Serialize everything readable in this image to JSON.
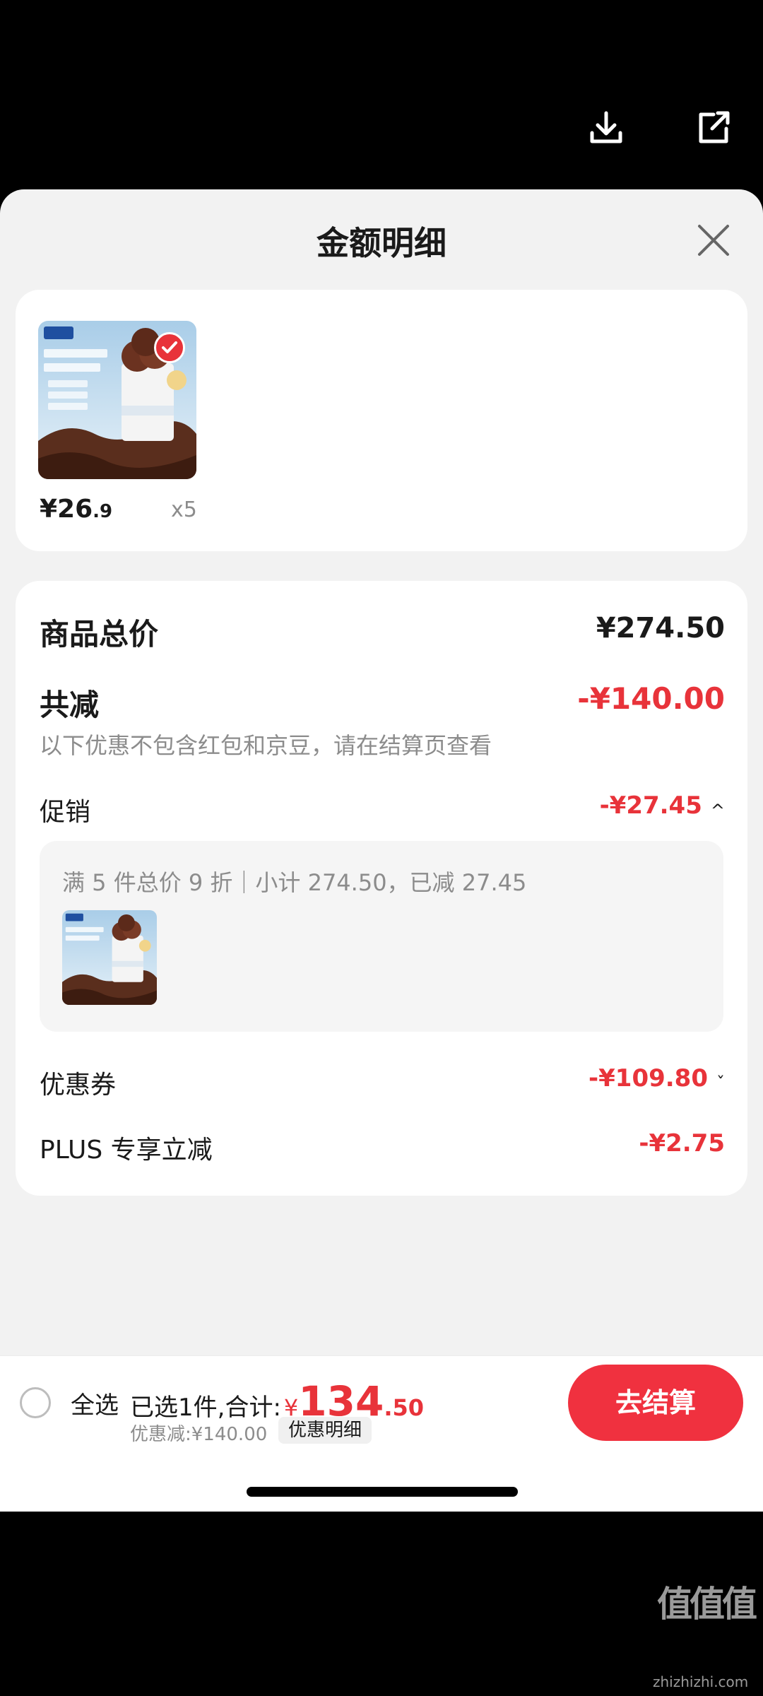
{
  "topbar": {
    "download_icon": "download-icon",
    "share_icon": "share-icon"
  },
  "sheet": {
    "title": "金额明细",
    "close_icon": "close-icon"
  },
  "product": {
    "image": "ice-cream-product-image",
    "checked": true,
    "price_main": "¥26",
    "price_decimal": ".9",
    "quantity": "x5"
  },
  "summary": {
    "total_label": "商品总价",
    "total_value": "¥274.50",
    "reduction_label": "共减",
    "reduction_value": "-¥140.00",
    "note": "以下优惠不包含红包和京豆，请在结算页查看",
    "promo_label": "促销",
    "promo_value": "-¥27.45",
    "promo_caret": "^",
    "promo_detail": "满 5 件总价 9 折｜小计 274.50，已减 27.45",
    "coupon_label": "优惠券",
    "coupon_value": "-¥109.80",
    "coupon_caret": "ˇ",
    "plus_label": "PLUS 专享立减",
    "plus_value": "-¥2.75"
  },
  "bottom_bar": {
    "select_all": "全选",
    "selected_text": "已选1件,合计:",
    "currency": "¥",
    "total_int": "134",
    "total_dec": ".50",
    "discount_note": "优惠减:¥140.00",
    "detail_tag": "优惠明细",
    "checkout": "去结算"
  },
  "watermark": {
    "logo": "值值值",
    "url": "zhizhizhi.com"
  },
  "colors": {
    "accent_red": "#e8333a",
    "checkout_red": "#f0313f",
    "sheet_bg": "#f2f2f2",
    "muted_text": "#8c8c8c"
  }
}
